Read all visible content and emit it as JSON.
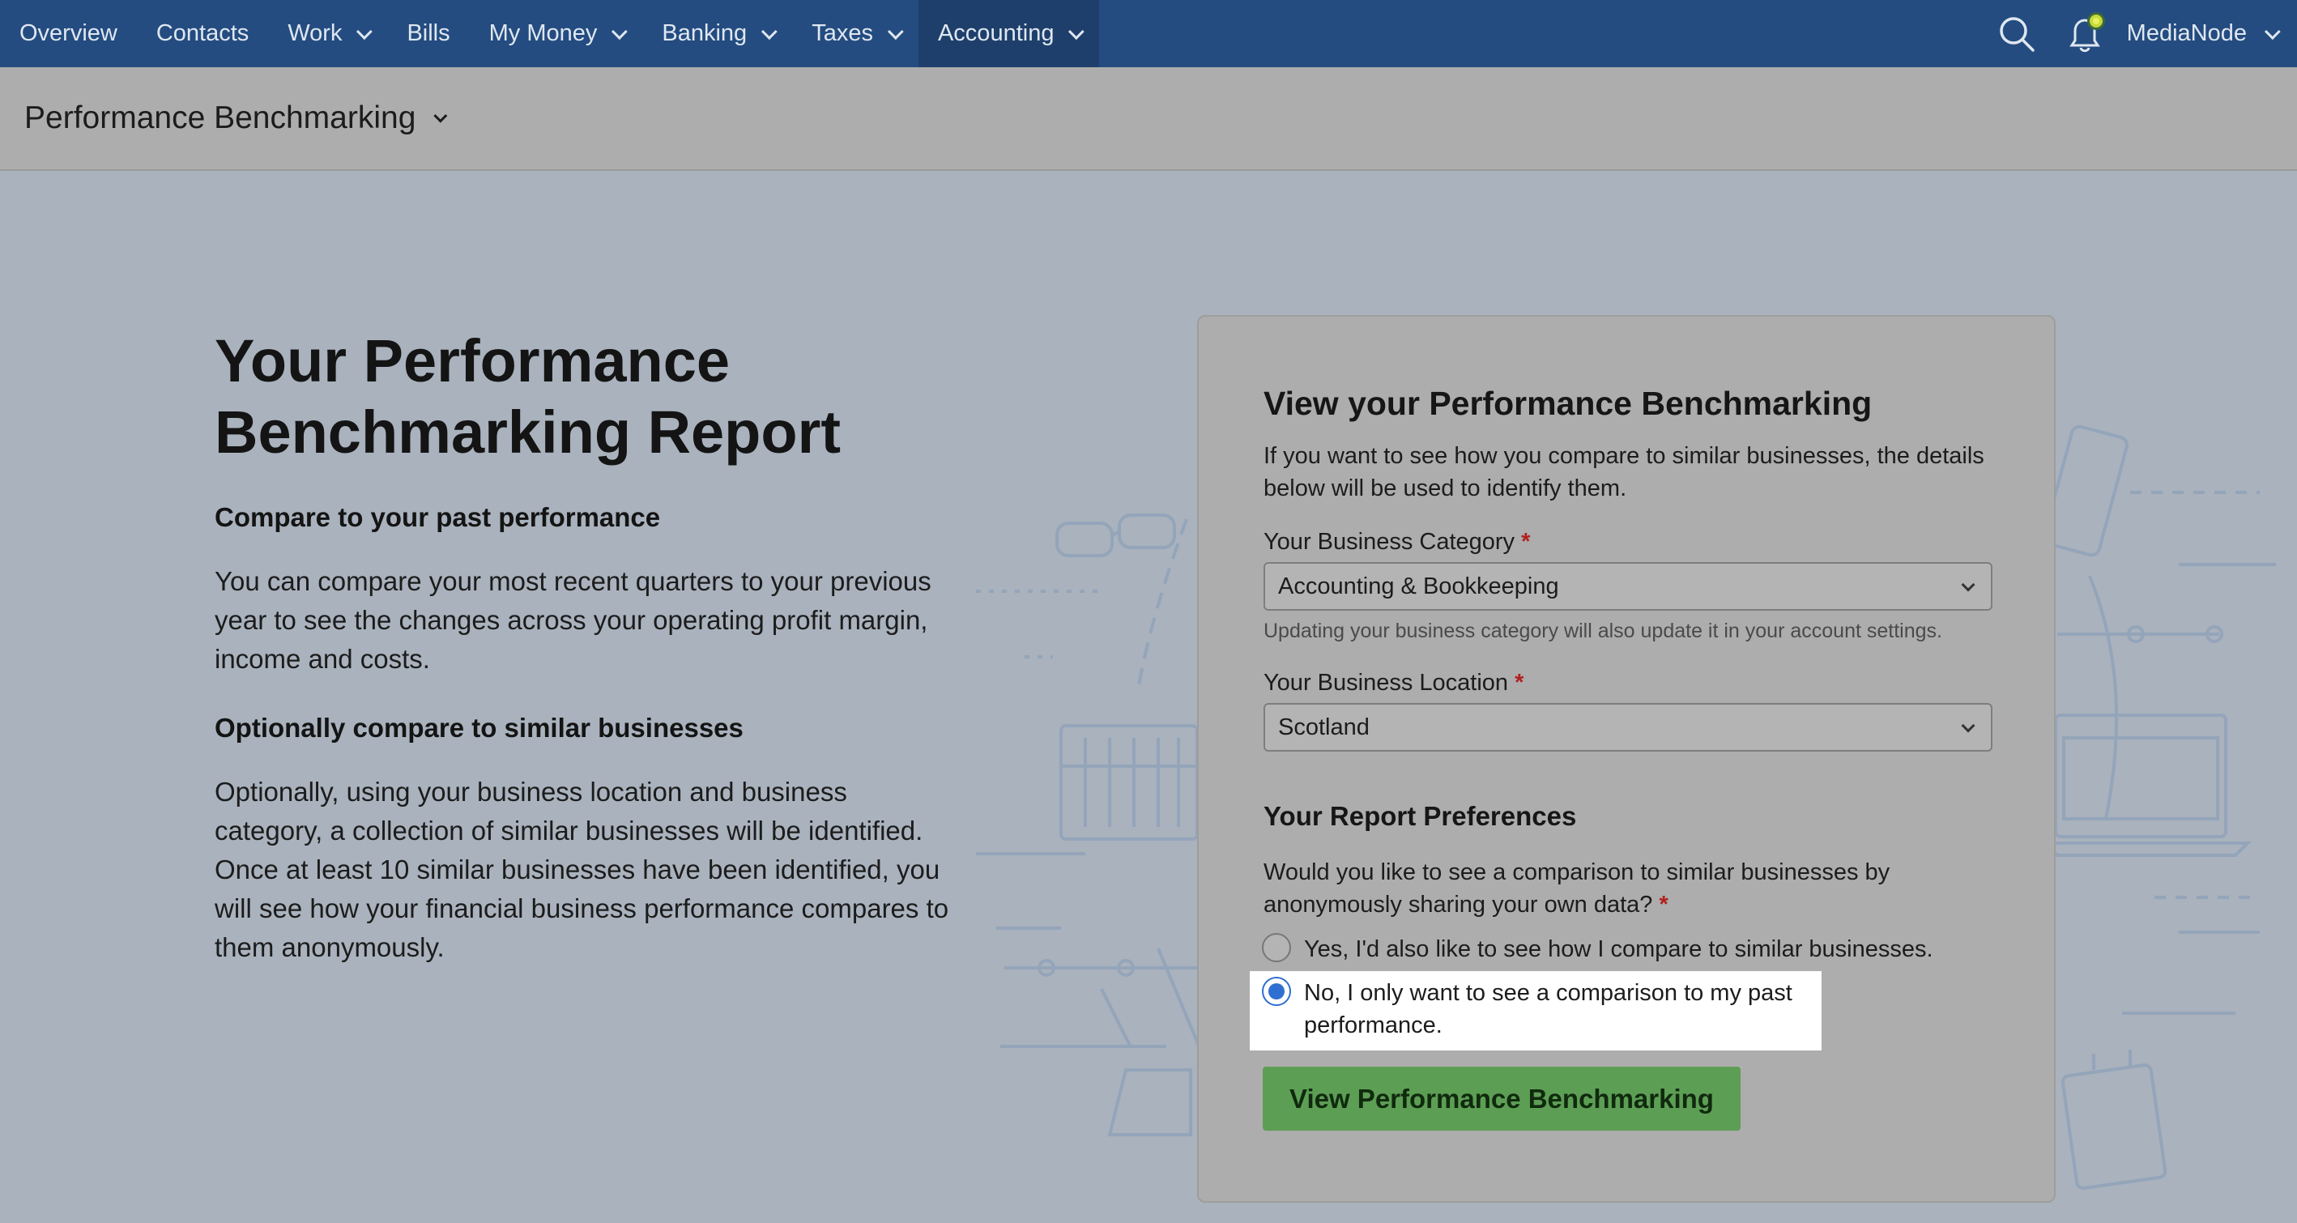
{
  "nav": {
    "items": [
      {
        "label": "Overview",
        "has_menu": false
      },
      {
        "label": "Contacts",
        "has_menu": false
      },
      {
        "label": "Work",
        "has_menu": true
      },
      {
        "label": "Bills",
        "has_menu": false
      },
      {
        "label": "My Money",
        "has_menu": true
      },
      {
        "label": "Banking",
        "has_menu": true
      },
      {
        "label": "Taxes",
        "has_menu": true
      },
      {
        "label": "Accounting",
        "has_menu": true,
        "active": true
      }
    ],
    "account_label": "MediaNode",
    "icons": [
      "search-icon",
      "notification-bell-icon"
    ]
  },
  "subheader": {
    "title": "Performance Benchmarking"
  },
  "left": {
    "title_line1": "Your Performance",
    "title_line2": "Benchmarking Report",
    "section1_heading": "Compare to your past performance",
    "section1_text": "You can compare your most recent quarters to your previous year to see the changes across your operating profit margin, income and costs.",
    "section2_heading": "Optionally compare to similar businesses",
    "section2_text": "Optionally, using your business location and business category, a collection of similar businesses will be identified. Once at least 10 similar businesses have been identified, you will see how your financial business performance compares to them anonymously."
  },
  "card": {
    "title": "View your Performance Benchmarking",
    "intro": "If you want to see how you compare to similar businesses, the details below will be used to identify them.",
    "category_label": "Your Business Category",
    "category_value": "Accounting & Bookkeeping",
    "category_hint": "Updating your business category will also update it in your account settings.",
    "location_label": "Your Business Location",
    "location_value": "Scotland",
    "required_marker": "*",
    "prefs_title": "Your Report Preferences",
    "question": "Would you like to see a comparison to similar businesses by anonymously sharing your own data?",
    "option_yes": "Yes, I'd also like to see how I compare to similar businesses.",
    "option_no": "No, I only want to see a comparison to my past performance.",
    "selected_option": "no",
    "cta_label": "View Performance Benchmarking"
  },
  "colors": {
    "nav_bg": "#244c80",
    "nav_active_bg": "#1e3f6b",
    "cta_bg": "#5d9e55",
    "radio_accent": "#2f6fd1",
    "required": "#b12020"
  }
}
